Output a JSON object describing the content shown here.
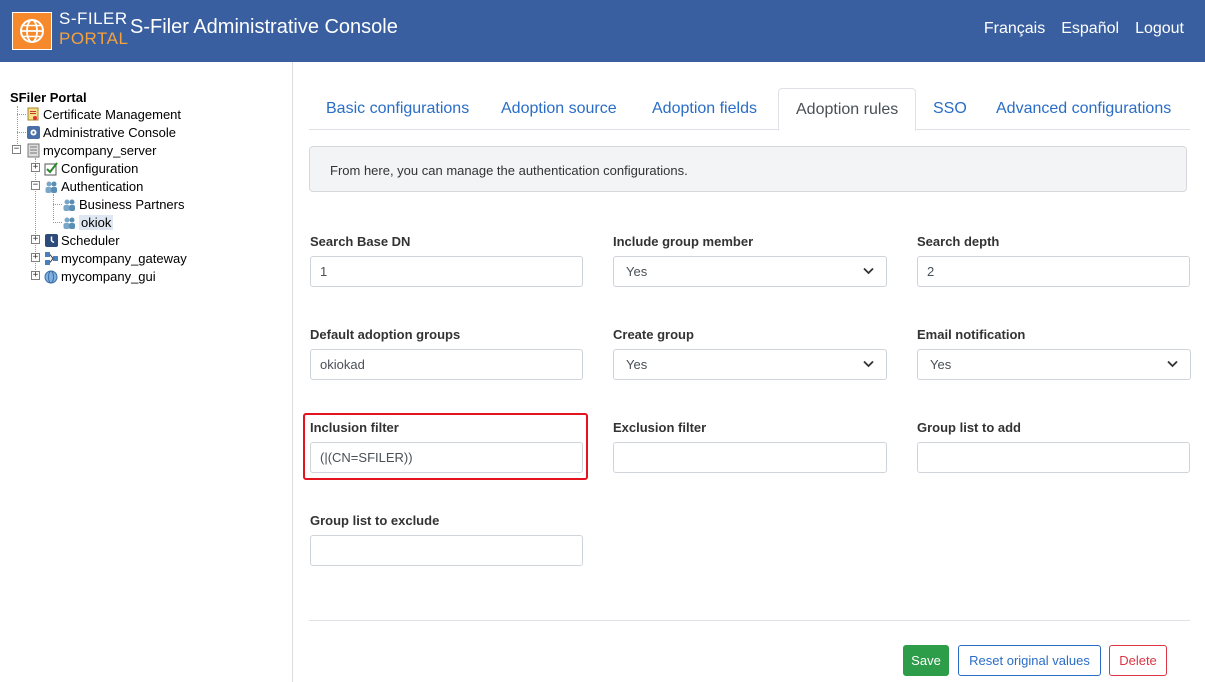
{
  "header": {
    "logo_line1": "S-FILER",
    "logo_line2": "PORTAL",
    "title": "S-Filer Administrative Console",
    "links": [
      "Français",
      "Español",
      "Logout"
    ],
    "logo_icon": "globe-icon",
    "colors": {
      "header_bg": "#3a5fa0",
      "logo_bg": "#f5892b"
    }
  },
  "tree": {
    "root": "SFiler Portal",
    "certificate_management": "Certificate Management",
    "administrative_console": "Administrative Console",
    "server": "mycompany_server",
    "configuration": "Configuration",
    "authentication": "Authentication",
    "business_partners": "Business Partners",
    "okiok": "okiok",
    "scheduler": "Scheduler",
    "gateway": "mycompany_gateway",
    "gui": "mycompany_gui"
  },
  "tabs": [
    "Basic configurations",
    "Adoption source",
    "Adoption fields",
    "Adoption rules",
    "SSO",
    "Advanced configurations"
  ],
  "active_tab": "Adoption rules",
  "info": "From here, you can manage the authentication configurations.",
  "form": {
    "search_base_dn": {
      "label": "Search Base DN",
      "value": "1"
    },
    "include_group_member": {
      "label": "Include group member",
      "value": "Yes"
    },
    "search_depth": {
      "label": "Search depth",
      "value": "2"
    },
    "default_adoption_groups": {
      "label": "Default adoption groups",
      "value": "okiokad"
    },
    "create_group": {
      "label": "Create group",
      "value": "Yes"
    },
    "email_notification": {
      "label": "Email notification",
      "value": "Yes"
    },
    "inclusion_filter": {
      "label": "Inclusion filter",
      "value": "(|(CN=SFILER))"
    },
    "exclusion_filter": {
      "label": "Exclusion filter",
      "value": ""
    },
    "group_list_to_add": {
      "label": "Group list to add",
      "value": ""
    },
    "group_list_to_exclude": {
      "label": "Group list to exclude",
      "value": ""
    }
  },
  "buttons": {
    "save": "Save",
    "reset": "Reset original values",
    "delete": "Delete"
  },
  "colors": {
    "save": "#2e9d4a",
    "reset": "#2a6dc7",
    "delete": "#dc3545",
    "highlight": "#e3141e"
  }
}
